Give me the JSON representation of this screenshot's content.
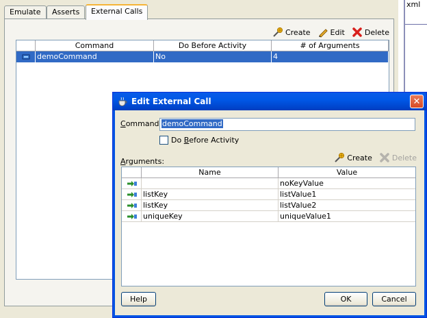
{
  "background": {
    "right_fragment": "xml",
    "tabs": [
      {
        "label": "Emulate",
        "active": false
      },
      {
        "label": "Asserts",
        "active": false
      },
      {
        "label": "External Calls",
        "active": true
      }
    ],
    "toolbar": {
      "create": "Create",
      "edit": "Edit",
      "delete": "Delete"
    },
    "table": {
      "columns": [
        "Command",
        "Do Before Activity",
        "# of Arguments"
      ],
      "rows": [
        {
          "command": "demoCommand",
          "do_before": "No",
          "args": "4",
          "selected": true
        }
      ]
    }
  },
  "dialog": {
    "title": "Edit External Call",
    "command_label_prefix": "C",
    "command_label_rest": "ommand:",
    "command_value": "demoCommand",
    "checkbox_prefix": "Do ",
    "checkbox_accel": "B",
    "checkbox_rest": "efore Activity",
    "checkbox_checked": false,
    "arguments_label_prefix": "A",
    "arguments_label_rest": "rguments:",
    "arg_toolbar": {
      "create": "Create",
      "delete": "Delete",
      "delete_enabled": false
    },
    "arg_table": {
      "columns": [
        "Name",
        "Value"
      ],
      "rows": [
        {
          "name": "",
          "value": "noKeyValue"
        },
        {
          "name": "listKey",
          "value": "listValue1"
        },
        {
          "name": "listKey",
          "value": "listValue2"
        },
        {
          "name": "uniqueKey",
          "value": "uniqueValue1"
        }
      ]
    },
    "buttons": {
      "help": "Help",
      "ok": "OK",
      "cancel": "Cancel"
    }
  },
  "colors": {
    "selection": "#316ac5",
    "title_bar": "#0058e6",
    "close": "#d94a24"
  }
}
